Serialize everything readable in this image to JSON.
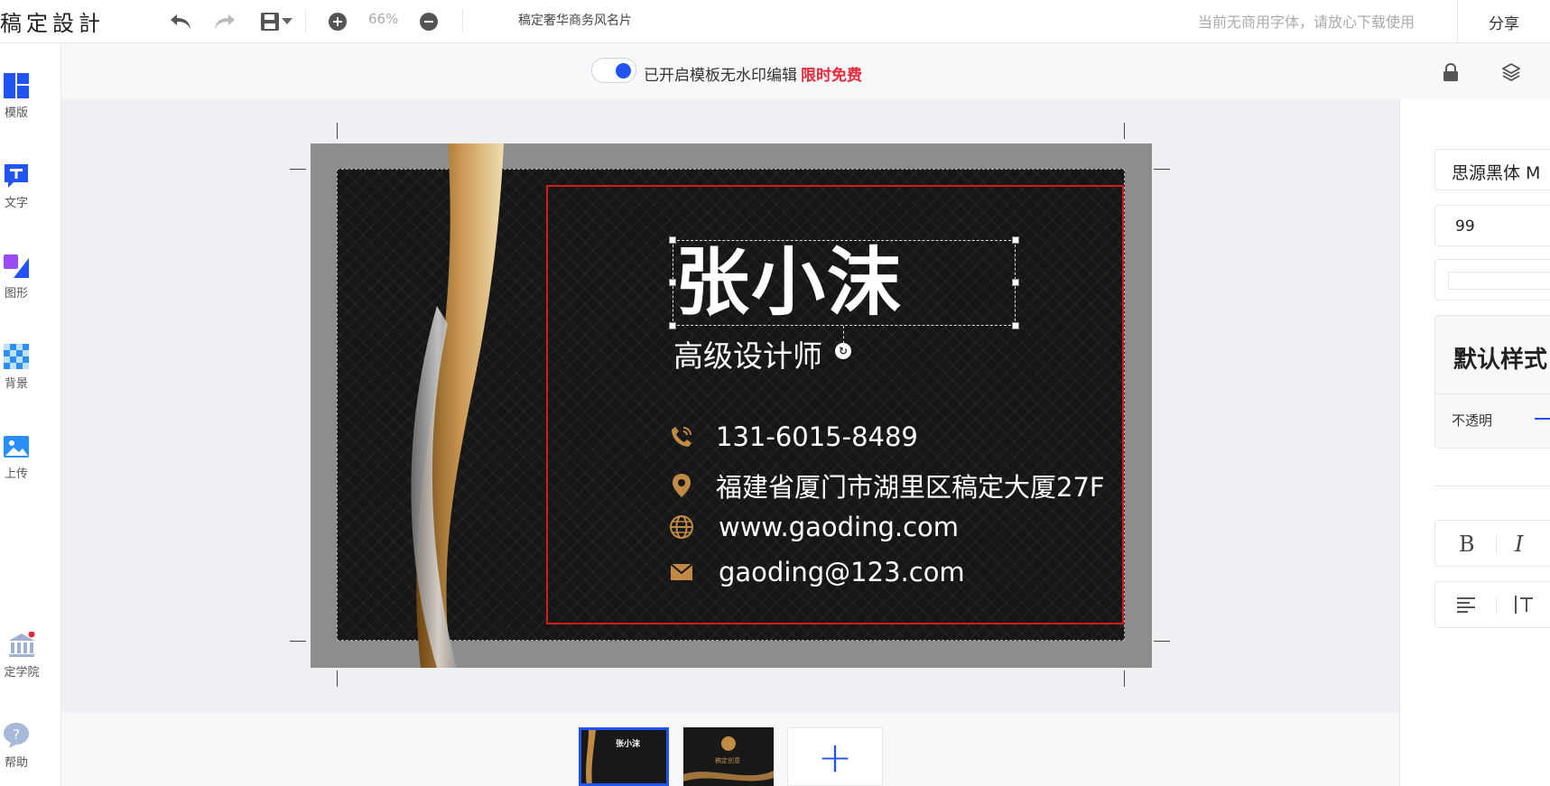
{
  "app": {
    "logo": "稿定設計",
    "doc_title": "稿定奢华商务风名片",
    "font_notice": "当前无商用字体，请放心下载使用",
    "share_label": "分享",
    "zoom": "66%"
  },
  "left_nav": {
    "items": [
      {
        "label": "模版",
        "icon": "template-icon"
      },
      {
        "label": "文字",
        "icon": "text-icon"
      },
      {
        "label": "图形",
        "icon": "shape-icon"
      },
      {
        "label": "背景",
        "icon": "background-icon"
      },
      {
        "label": "上传",
        "icon": "upload-icon"
      },
      {
        "label": "定学院",
        "icon": "academy-icon"
      },
      {
        "label": "帮助",
        "icon": "help-icon"
      }
    ]
  },
  "subbar": {
    "watermark_text": "已开启模板无水印编辑",
    "free_badge": "限时免费"
  },
  "card": {
    "name": "张小沫",
    "role": "高级设计师",
    "phone": "131-6015-8489",
    "address": "福建省厦门市湖里区稿定大厦27F",
    "website": "www.gaoding.com",
    "email": "gaoding@123.com"
  },
  "thumbs": {
    "page1_name": "张小沫",
    "page2_brand": "稿定创意"
  },
  "right_panel": {
    "font_family": "思源黑体 M",
    "font_size": "99",
    "style_title": "默认样式",
    "opacity_label": "不透明",
    "bold_label": "B",
    "italic_label": "I"
  },
  "colors": {
    "accent": "#2254f4",
    "free_red": "#e5293b",
    "frame_red": "#d41b1b",
    "gold": "#c08a45"
  }
}
